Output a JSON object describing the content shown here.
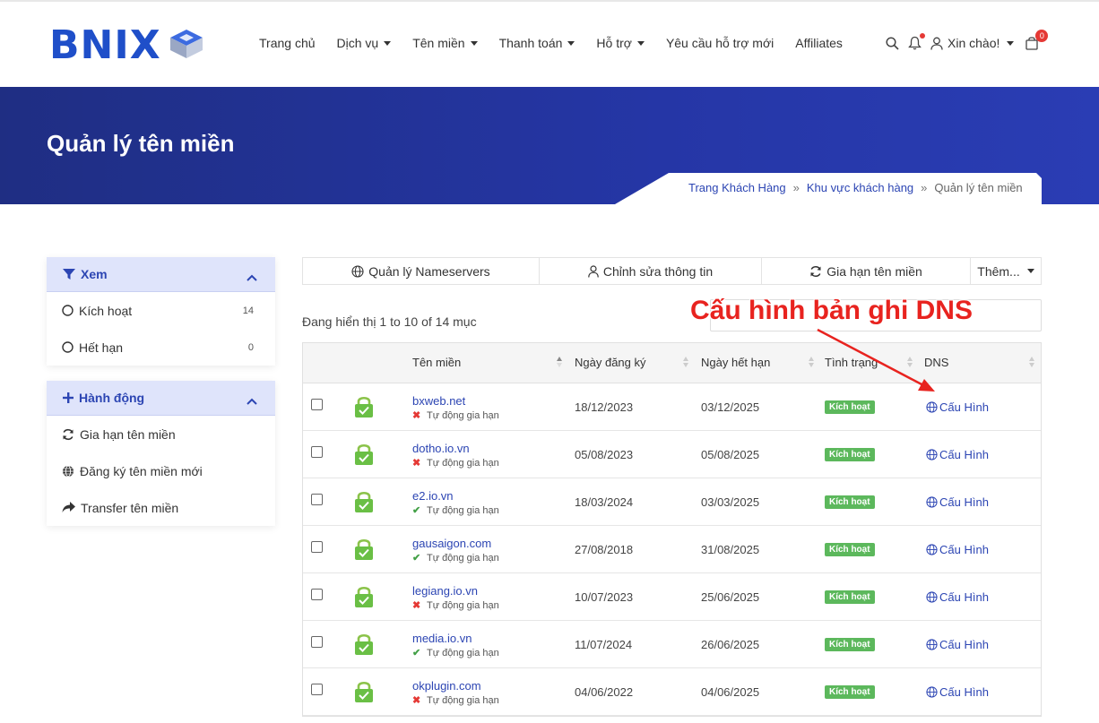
{
  "header": {
    "logo_text": "BNIX",
    "nav": [
      {
        "label": "Trang chủ",
        "dropdown": false
      },
      {
        "label": "Dịch vụ",
        "dropdown": true
      },
      {
        "label": "Tên miền",
        "dropdown": true
      },
      {
        "label": "Thanh toán",
        "dropdown": true
      },
      {
        "label": "Hỗ trợ",
        "dropdown": true
      },
      {
        "label": "Yêu cầu hỗ trợ mới",
        "dropdown": false
      },
      {
        "label": "Affiliates",
        "dropdown": false
      }
    ],
    "greeting": "Xin chào!",
    "cart_count": "0"
  },
  "banner": {
    "title": "Quản lý tên miền",
    "breadcrumb": [
      "Trang Khách Hàng",
      "Khu vực khách hàng",
      "Quản lý tên miền"
    ]
  },
  "sidebar": {
    "view": {
      "title": "Xem",
      "items": [
        {
          "label": "Kích hoạt",
          "count": "14"
        },
        {
          "label": "Hết hạn",
          "count": "0"
        }
      ]
    },
    "actions": {
      "title": "Hành động",
      "items": [
        {
          "label": "Gia hạn tên miền",
          "icon": "refresh-icon"
        },
        {
          "label": "Đăng ký tên miền mới",
          "icon": "globe-icon"
        },
        {
          "label": "Transfer tên miền",
          "icon": "share-icon"
        }
      ]
    }
  },
  "toolbar": {
    "nameservers": "Quản lý Nameservers",
    "edit_info": "Chỉnh sửa thông tin",
    "renew": "Gia hạn tên miền",
    "more": "Thêm..."
  },
  "table": {
    "showing": "Đang hiển thị 1 to 10 of 14 mục",
    "headers": {
      "domain": "Tên miền",
      "reg_date": "Ngày đăng ký",
      "exp_date": "Ngày hết hạn",
      "status": "Tình trạng",
      "dns": "DNS"
    },
    "rows": [
      {
        "domain": "bxweb.net",
        "auto_renew": false,
        "auto_label": "Tự động gia hạn",
        "reg": "18/12/2023",
        "exp": "03/12/2025",
        "status": "Kích hoạt",
        "dns": "Cấu Hình"
      },
      {
        "domain": "dotho.io.vn",
        "auto_renew": false,
        "auto_label": "Tự động gia hạn",
        "reg": "05/08/2023",
        "exp": "05/08/2025",
        "status": "Kích hoạt",
        "dns": "Cấu Hình"
      },
      {
        "domain": "e2.io.vn",
        "auto_renew": true,
        "auto_label": "Tự động gia hạn",
        "reg": "18/03/2024",
        "exp": "03/03/2025",
        "status": "Kích hoạt",
        "dns": "Cấu Hình"
      },
      {
        "domain": "gausaigon.com",
        "auto_renew": true,
        "auto_label": "Tự động gia hạn",
        "reg": "27/08/2018",
        "exp": "31/08/2025",
        "status": "Kích hoạt",
        "dns": "Cấu Hình"
      },
      {
        "domain": "legiang.io.vn",
        "auto_renew": false,
        "auto_label": "Tự động gia hạn",
        "reg": "10/07/2023",
        "exp": "25/06/2025",
        "status": "Kích hoạt",
        "dns": "Cấu Hình"
      },
      {
        "domain": "media.io.vn",
        "auto_renew": true,
        "auto_label": "Tự động gia hạn",
        "reg": "11/07/2024",
        "exp": "26/06/2025",
        "status": "Kích hoạt",
        "dns": "Cấu Hình"
      },
      {
        "domain": "okplugin.com",
        "auto_renew": false,
        "auto_label": "Tự động gia hạn",
        "reg": "04/06/2022",
        "exp": "04/06/2025",
        "status": "Kích hoạt",
        "dns": "Cấu Hình"
      }
    ]
  },
  "annotation": {
    "text": "Cấu hình bản ghi DNS",
    "color": "#e8231f"
  },
  "colors": {
    "brand": "#1f4fc9",
    "link": "#2c45b3",
    "banner": "#2536a6",
    "status_active": "#5cb85c"
  }
}
